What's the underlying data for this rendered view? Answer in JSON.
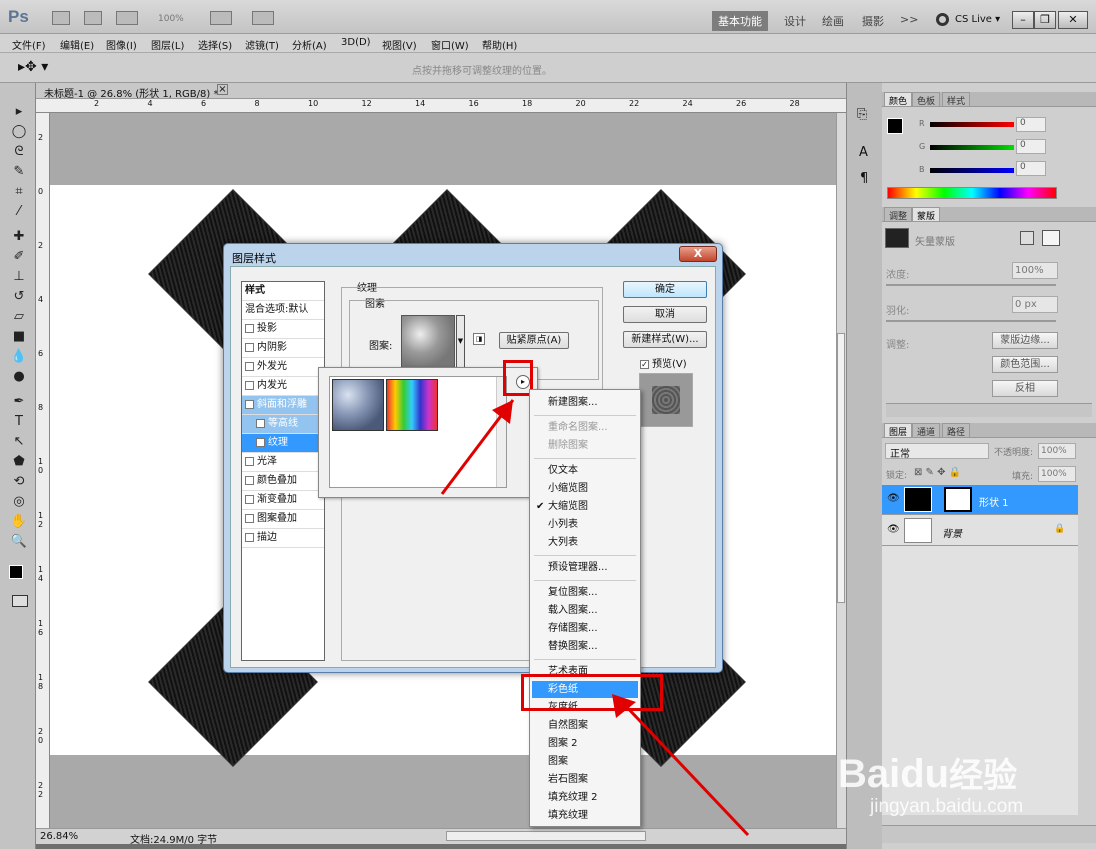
{
  "app": {
    "logo": "Ps",
    "zoom_dropdown": "100%",
    "workspace_buttons": [
      "基本功能",
      "设计",
      "绘画",
      "摄影"
    ],
    "more": ">>",
    "cslive": "CS Live ▾"
  },
  "menubar": [
    "文件(F)",
    "编辑(E)",
    "图像(I)",
    "图层(L)",
    "选择(S)",
    "滤镜(T)",
    "分析(A)",
    "3D(D)",
    "视图(V)",
    "窗口(W)",
    "帮助(H)"
  ],
  "optionsbar": {
    "hint": "点按并拖移可调整纹理的位置。"
  },
  "document": {
    "tab_title": "未标题-1 @ 26.8% (形状 1, RGB/8) *",
    "ruler_top": [
      "2",
      "4",
      "6",
      "8",
      "10",
      "12",
      "14",
      "16",
      "18",
      "20",
      "22",
      "24",
      "26",
      "28"
    ],
    "ruler_left": [
      "2",
      "0",
      "2",
      "4",
      "6",
      "8",
      "1 0",
      "1 2",
      "1 4",
      "1 6",
      "1 8",
      "2 0",
      "2 2"
    ],
    "status_zoom": "26.84%",
    "status_doc": "文档:24.9M/0 字节"
  },
  "dialog": {
    "title": "图层样式",
    "close": "X",
    "style_header": "样式",
    "blend_options": "混合选项:默认",
    "styles": [
      {
        "label": "投影",
        "checked": false
      },
      {
        "label": "内阴影",
        "checked": false
      },
      {
        "label": "外发光",
        "checked": false
      },
      {
        "label": "内发光",
        "checked": false
      },
      {
        "label": "斜面和浮雕",
        "checked": true
      },
      {
        "label": "等高线",
        "checked": false
      },
      {
        "label": "纹理",
        "checked": true
      },
      {
        "label": "光泽",
        "checked": false
      },
      {
        "label": "颜色叠加",
        "checked": false
      },
      {
        "label": "渐变叠加",
        "checked": false
      },
      {
        "label": "图案叠加",
        "checked": false
      },
      {
        "label": "描边",
        "checked": false
      }
    ],
    "section_title": "纹理",
    "subsection_title": "图素",
    "pattern_label": "图案:",
    "snap_button": "贴紧原点(A)",
    "ok": "确定",
    "cancel": "取消",
    "new_style": "新建样式(W)...",
    "preview": "预览(V)"
  },
  "context_menu": {
    "items": [
      {
        "label": "新建图案...",
        "disabled": false
      },
      {
        "sep": true
      },
      {
        "label": "重命名图案...",
        "disabled": true
      },
      {
        "label": "删除图案",
        "disabled": true
      },
      {
        "sep": true
      },
      {
        "label": "仅文本",
        "disabled": false
      },
      {
        "label": "小缩览图",
        "disabled": false
      },
      {
        "label": "大缩览图",
        "disabled": false,
        "checked": true
      },
      {
        "label": "小列表",
        "disabled": false
      },
      {
        "label": "大列表",
        "disabled": false
      },
      {
        "sep": true
      },
      {
        "label": "预设管理器...",
        "disabled": false
      },
      {
        "sep": true
      },
      {
        "label": "复位图案...",
        "disabled": false
      },
      {
        "label": "载入图案...",
        "disabled": false
      },
      {
        "label": "存储图案...",
        "disabled": false
      },
      {
        "label": "替换图案...",
        "disabled": false
      },
      {
        "sep": true
      },
      {
        "label": "艺术表面",
        "disabled": false
      },
      {
        "label": "彩色纸",
        "disabled": false,
        "highlight": true
      },
      {
        "label": "灰度纸",
        "disabled": false
      },
      {
        "label": "自然图案",
        "disabled": false
      },
      {
        "label": "图案 2",
        "disabled": false
      },
      {
        "label": "图案",
        "disabled": false
      },
      {
        "label": "岩石图案",
        "disabled": false
      },
      {
        "label": "填充纹理 2",
        "disabled": false
      },
      {
        "label": "填充纹理",
        "disabled": false
      }
    ]
  },
  "panels": {
    "color_tabs": [
      "颜色",
      "色板",
      "样式"
    ],
    "color_channels": [
      {
        "label": "R",
        "value": "0"
      },
      {
        "label": "G",
        "value": "0"
      },
      {
        "label": "B",
        "value": "0"
      }
    ],
    "adjust_tabs": [
      "调整",
      "蒙版"
    ],
    "mask_title": "矢量蒙版",
    "density_label": "浓度:",
    "density_value": "100%",
    "feather_label": "羽化:",
    "feather_value": "0 px",
    "refine_label": "调整:",
    "mask_edge_btn": "蒙版边缘...",
    "color_range_btn": "颜色范围...",
    "invert_btn": "反相",
    "layer_tabs": [
      "图层",
      "通道",
      "路径"
    ],
    "blend_mode": "正常",
    "opacity_label": "不透明度:",
    "opacity_value": "100%",
    "lock_label": "锁定:",
    "fill_label": "填充:",
    "fill_value": "100%",
    "layers": [
      {
        "name": "形状 1",
        "selected": true
      },
      {
        "name": "背景",
        "selected": false
      }
    ]
  },
  "watermark": {
    "brand": "Baidu",
    "cn": "经验",
    "url": "jingyan.baidu.com"
  },
  "colors": {
    "accent": "#3399ff",
    "annotation": "#e00000"
  }
}
